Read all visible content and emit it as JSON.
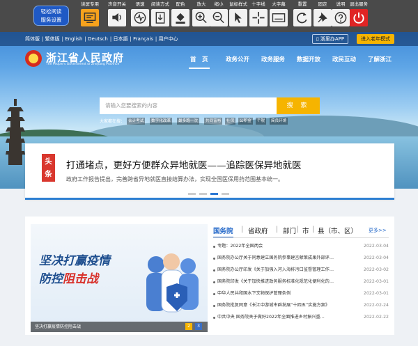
{
  "accessibility": {
    "brand": [
      "轻松阅读",
      "服务设置"
    ],
    "tools": [
      {
        "label": "读屏专用",
        "icon": "screen-reader-icon",
        "active": true
      },
      {
        "label": "声音开关",
        "icon": "speaker-icon"
      },
      {
        "label": "语速",
        "icon": "speech-rate-icon"
      },
      {
        "label": "阅读方式",
        "icon": "reading-mode-icon"
      },
      {
        "label": "配色",
        "icon": "color-icon"
      },
      {
        "label": "放大",
        "icon": "zoom-in-icon"
      },
      {
        "label": "缩小",
        "icon": "zoom-out-icon"
      },
      {
        "label": "鼠标样式",
        "icon": "cursor-icon"
      },
      {
        "label": "十字线",
        "icon": "crosshair-icon"
      },
      {
        "label": "大字幕",
        "icon": "caption-icon"
      },
      {
        "label": "重置",
        "icon": "reset-icon"
      },
      {
        "label": "固定",
        "icon": "pin-icon"
      },
      {
        "label": "说明",
        "icon": "help-icon"
      },
      {
        "label": "退出服务",
        "icon": "power-icon",
        "exit": true
      }
    ]
  },
  "header": {
    "lang_links": [
      "简体版",
      "繁体版",
      "English",
      "Deutsch",
      "日本語",
      "Français",
      "用户中心"
    ],
    "app_link": "浙里办APP",
    "elder_mode": "进入老年模式",
    "site_title": "浙江省人民政府",
    "site_subtitle": "The People's Government of Zhejiang Province",
    "nav": [
      "首　页",
      "政务公开",
      "政务服务",
      "数据开放",
      "政民互动",
      "了解浙江"
    ],
    "search_placeholder": "请输入您要搜索的内容",
    "search_button": "搜 索",
    "hot_label": "大家都在搜：",
    "hot_terms": [
      "会计考试",
      "数字化改革",
      "最多跑一次",
      "共同富裕",
      "社保",
      "公积金",
      "个税",
      "简良环境"
    ]
  },
  "headline": {
    "badge": [
      "头",
      "条"
    ],
    "title": "打通堵点，更好方便群众异地就医——追踪医保异地就医",
    "summary": "政府工作报告提出，完善跨省异地就医直接结算办法，实现全国医保用药范围基本统一。"
  },
  "lower": {
    "banner_line1": "坚决打赢疫情",
    "banner_line2a": "防控",
    "banner_line2b": "阻击战",
    "banner_caption": "坚决打赢疫情防控阻击战",
    "banner_pages": [
      "2",
      "3"
    ],
    "tabs": [
      "国务院",
      "省政府",
      "部门",
      "市",
      "县（市、区）"
    ],
    "separators": [
      "|",
      "|",
      "|",
      "|"
    ],
    "more": "更多>>",
    "news": [
      {
        "title": "专题：2022年全国两会",
        "date": "2022-03-04"
      },
      {
        "title": "国务院办公厅关于同意建立国务院参事建言献策成果外部评…",
        "date": "2022-03-04"
      },
      {
        "title": "国务院办公厅印发《关于加强入河入海排污口监督管理工作…",
        "date": "2022-03-02"
      },
      {
        "title": "国务院印发《关于加快推进政务服务标准化规范化便利化的…",
        "date": "2022-03-01"
      },
      {
        "title": "中华人民共和国水下文物保护管理条例",
        "date": "2022-03-01"
      },
      {
        "title": "国务院批复同意《长江中游城市群发展“十四五”实施方案》",
        "date": "2022-02-24"
      },
      {
        "title": "中共中央 国务院关于做好2022年全面推进乡村振兴重…",
        "date": "2022-02-22"
      }
    ]
  },
  "colors": {
    "toolbar": "#4a4a4a",
    "accent": "#f6b400",
    "primary": "#2468c9",
    "badge": "#d9372e"
  }
}
